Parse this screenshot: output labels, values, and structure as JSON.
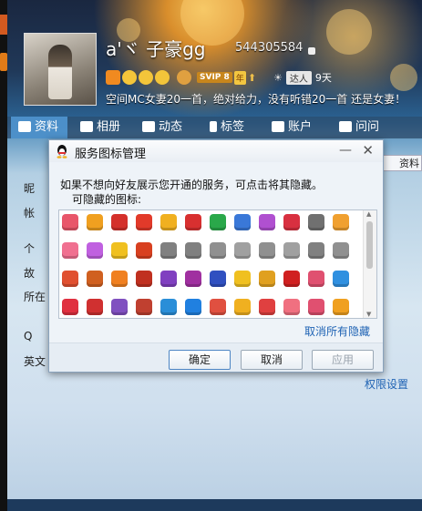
{
  "profile": {
    "nickname": "a'ヾ 子豪gg",
    "qq_number": "544305584",
    "vip_badge": "SVIP 8",
    "year_badge": "年",
    "daren_label": "达人",
    "daren_days": "9天",
    "signature": "空间MC女妻20一首，绝对给力，没有听错20一首 还是女妻！",
    "tabs": [
      {
        "label": "资料",
        "icon": "profile-card-icon"
      },
      {
        "label": "相册",
        "icon": "album-icon"
      },
      {
        "label": "动态",
        "icon": "feed-icon"
      },
      {
        "label": "标签",
        "icon": "tag-icon"
      },
      {
        "label": "账户",
        "icon": "wallet-icon"
      },
      {
        "label": "问问",
        "icon": "question-icon"
      }
    ],
    "side_labels": [
      "昵",
      "帐",
      "个",
      "故",
      "所在",
      "Q",
      "英文"
    ],
    "edit_button": "资料",
    "permission_link": "权限设置"
  },
  "dialog": {
    "title": "服务图标管理",
    "minimize_label": "—",
    "close_label": "✕",
    "description": "如果不想向好友展示您开通的服务，可点击将其隐藏。",
    "hidable_label": "可隐藏的图标:",
    "unhide_all": "取消所有隐藏",
    "ok": "确定",
    "cancel": "取消",
    "apply": "应用",
    "icon_colors": [
      "#e8566a",
      "#f0a020",
      "#d4302b",
      "#e23a2a",
      "#f0b020",
      "#d83030",
      "#2aa84a",
      "#3a78d8",
      "#b050d0",
      "#d83040",
      "#707070",
      "#f0a030",
      "#f07090",
      "#c060e0",
      "#f0c020",
      "#d84020",
      "#808080",
      "#808080",
      "#909090",
      "#a0a0a0",
      "#909090",
      "#a0a0a0",
      "#808080",
      "#909090",
      "#e05030",
      "#d06020",
      "#f08020",
      "#c03020",
      "#8040c0",
      "#a030a0",
      "#3050c0",
      "#f0c020",
      "#e0a020",
      "#d02020",
      "#e05070",
      "#3090e0",
      "#e03040",
      "#d03030",
      "#8050c0",
      "#c04030",
      "#2a8ed8",
      "#2080e0",
      "#e05040",
      "#f0b020",
      "#e04040",
      "#f07080",
      "#e05070",
      "#f0a020",
      "#f08020",
      "#d06030",
      "#e0c020",
      "#e06020",
      "#b070c0",
      "#20a070",
      "#a04020",
      "#d0a020",
      "#e08040",
      "#e0d020",
      "#707070",
      "#e03020"
    ]
  }
}
